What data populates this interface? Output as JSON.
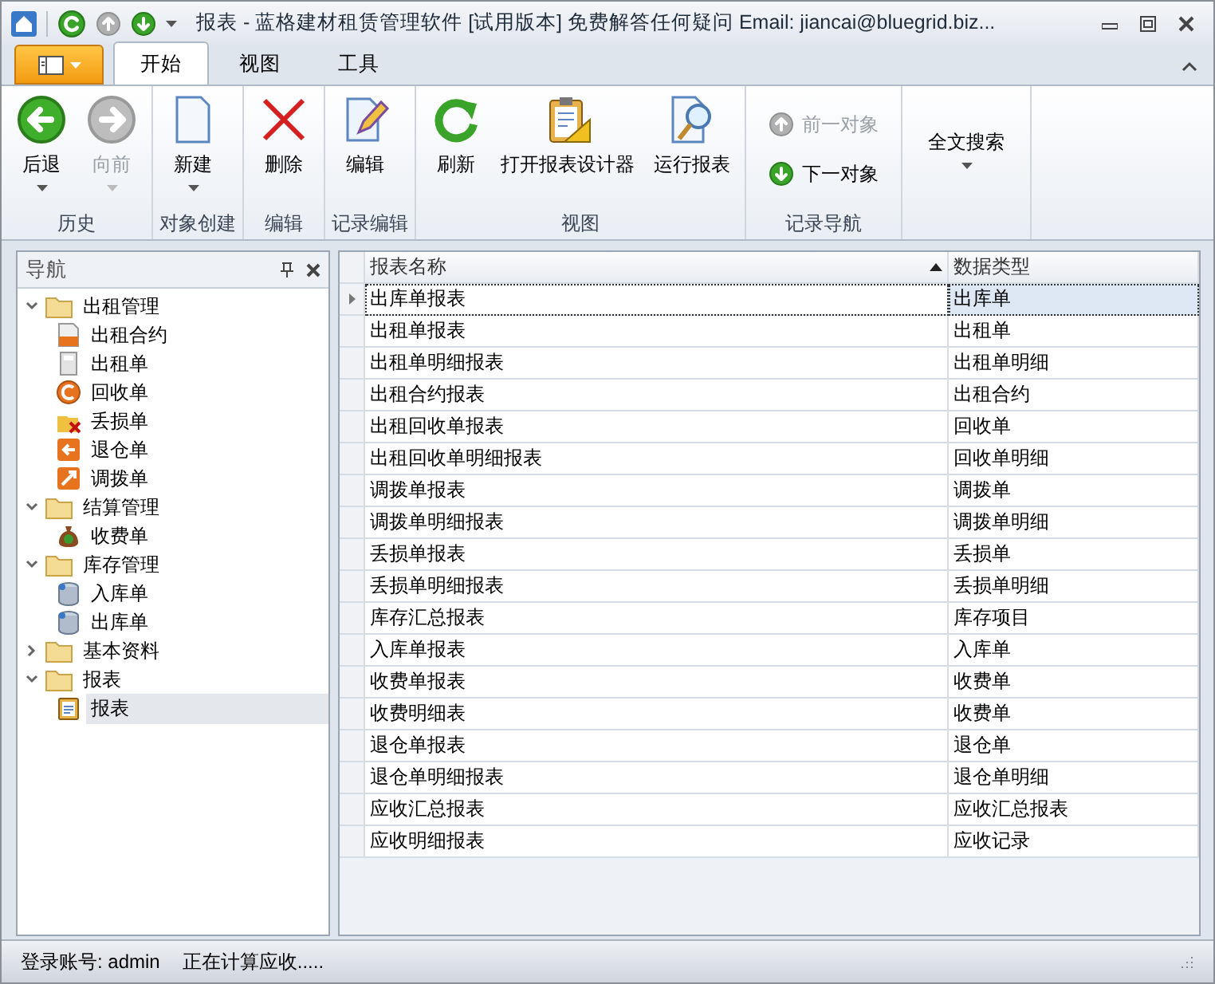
{
  "window": {
    "title": "报表 - 蓝格建材租赁管理软件 [试用版本] 免费解答任何疑问 Email:  jiancai@bluegrid.biz..."
  },
  "ribbon_tabs": [
    {
      "label": "开始",
      "selected": true
    },
    {
      "label": "视图",
      "selected": false
    },
    {
      "label": "工具",
      "selected": false
    }
  ],
  "ribbon_groups": [
    {
      "label": "历史",
      "large_buttons": [
        {
          "label": "后退",
          "kind": "back",
          "disabled": false,
          "dropdown": true
        },
        {
          "label": "向前",
          "kind": "forward",
          "disabled": true,
          "dropdown": true
        }
      ]
    },
    {
      "label": "对象创建",
      "large_buttons": [
        {
          "label": "新建",
          "kind": "new",
          "disabled": false,
          "dropdown": true
        }
      ]
    },
    {
      "label": "编辑",
      "large_buttons": [
        {
          "label": "删除",
          "kind": "delete",
          "disabled": false,
          "dropdown": false
        }
      ]
    },
    {
      "label": "记录编辑",
      "large_buttons": [
        {
          "label": "编辑",
          "kind": "edit",
          "disabled": false,
          "dropdown": false
        }
      ]
    },
    {
      "label": "视图",
      "large_buttons": [
        {
          "label": "刷新",
          "kind": "refresh",
          "disabled": false,
          "dropdown": false
        },
        {
          "label": "打开报表设计器",
          "kind": "designer",
          "disabled": false,
          "dropdown": false
        },
        {
          "label": "运行报表",
          "kind": "run",
          "disabled": false,
          "dropdown": false
        }
      ]
    },
    {
      "label": "记录导航",
      "small_buttons": [
        {
          "label": "前一对象",
          "kind": "up",
          "disabled": true
        },
        {
          "label": "下一对象",
          "kind": "down",
          "disabled": false
        }
      ]
    },
    {
      "large_buttons": [
        {
          "label": "全文搜索",
          "kind": "text",
          "disabled": false,
          "dropdown": true
        }
      ]
    }
  ],
  "navigation": {
    "title": "导航",
    "tree": [
      {
        "label": "出租管理",
        "kind": "folder",
        "expanded": true,
        "selected": false,
        "children": [
          {
            "label": "出租合约",
            "kind": "contract",
            "selected": false
          },
          {
            "label": "出租单",
            "kind": "calc",
            "selected": false
          },
          {
            "label": "回收单",
            "kind": "recycle",
            "selected": false
          },
          {
            "label": "丢损单",
            "kind": "loss",
            "selected": false
          },
          {
            "label": "退仓单",
            "kind": "return",
            "selected": false
          },
          {
            "label": "调拨单",
            "kind": "transfer",
            "selected": false
          }
        ]
      },
      {
        "label": "结算管理",
        "kind": "folder",
        "expanded": true,
        "selected": false,
        "children": [
          {
            "label": "收费单",
            "kind": "money",
            "selected": false
          }
        ]
      },
      {
        "label": "库存管理",
        "kind": "folder",
        "expanded": true,
        "selected": false,
        "children": [
          {
            "label": "入库单",
            "kind": "db",
            "selected": false
          },
          {
            "label": "出库单",
            "kind": "db",
            "selected": false
          }
        ]
      },
      {
        "label": "基本资料",
        "kind": "folder",
        "expanded": false,
        "selected": false
      },
      {
        "label": "报表",
        "kind": "folder",
        "expanded": true,
        "selected": false,
        "children": [
          {
            "label": "报表",
            "kind": "report",
            "selected": true
          }
        ]
      }
    ]
  },
  "grid": {
    "columns": [
      {
        "label": "报表名称",
        "sorted": true
      },
      {
        "label": "数据类型",
        "sorted": false
      }
    ],
    "rows": [
      {
        "cells": [
          "出库单报表",
          "出库单"
        ],
        "selected": true
      },
      {
        "cells": [
          "出租单报表",
          "出租单"
        ],
        "selected": false
      },
      {
        "cells": [
          "出租单明细报表",
          "出租单明细"
        ],
        "selected": false
      },
      {
        "cells": [
          "出租合约报表",
          "出租合约"
        ],
        "selected": false
      },
      {
        "cells": [
          "出租回收单报表",
          "回收单"
        ],
        "selected": false
      },
      {
        "cells": [
          "出租回收单明细报表",
          "回收单明细"
        ],
        "selected": false
      },
      {
        "cells": [
          "调拨单报表",
          "调拨单"
        ],
        "selected": false
      },
      {
        "cells": [
          "调拨单明细报表",
          "调拨单明细"
        ],
        "selected": false
      },
      {
        "cells": [
          "丢损单报表",
          "丢损单"
        ],
        "selected": false
      },
      {
        "cells": [
          "丢损单明细报表",
          "丢损单明细"
        ],
        "selected": false
      },
      {
        "cells": [
          "库存汇总报表",
          "库存项目"
        ],
        "selected": false
      },
      {
        "cells": [
          "入库单报表",
          "入库单"
        ],
        "selected": false
      },
      {
        "cells": [
          "收费单报表",
          "收费单"
        ],
        "selected": false
      },
      {
        "cells": [
          "收费明细表",
          "收费单"
        ],
        "selected": false
      },
      {
        "cells": [
          "退仓单报表",
          "退仓单"
        ],
        "selected": false
      },
      {
        "cells": [
          "退仓单明细报表",
          "退仓单明细"
        ],
        "selected": false
      },
      {
        "cells": [
          "应收汇总报表",
          "应收汇总报表"
        ],
        "selected": false
      },
      {
        "cells": [
          "应收明细报表",
          "应收记录"
        ],
        "selected": false
      }
    ]
  },
  "status_bar": {
    "user": "登录账号: admin",
    "message": "正在计算应收....."
  }
}
